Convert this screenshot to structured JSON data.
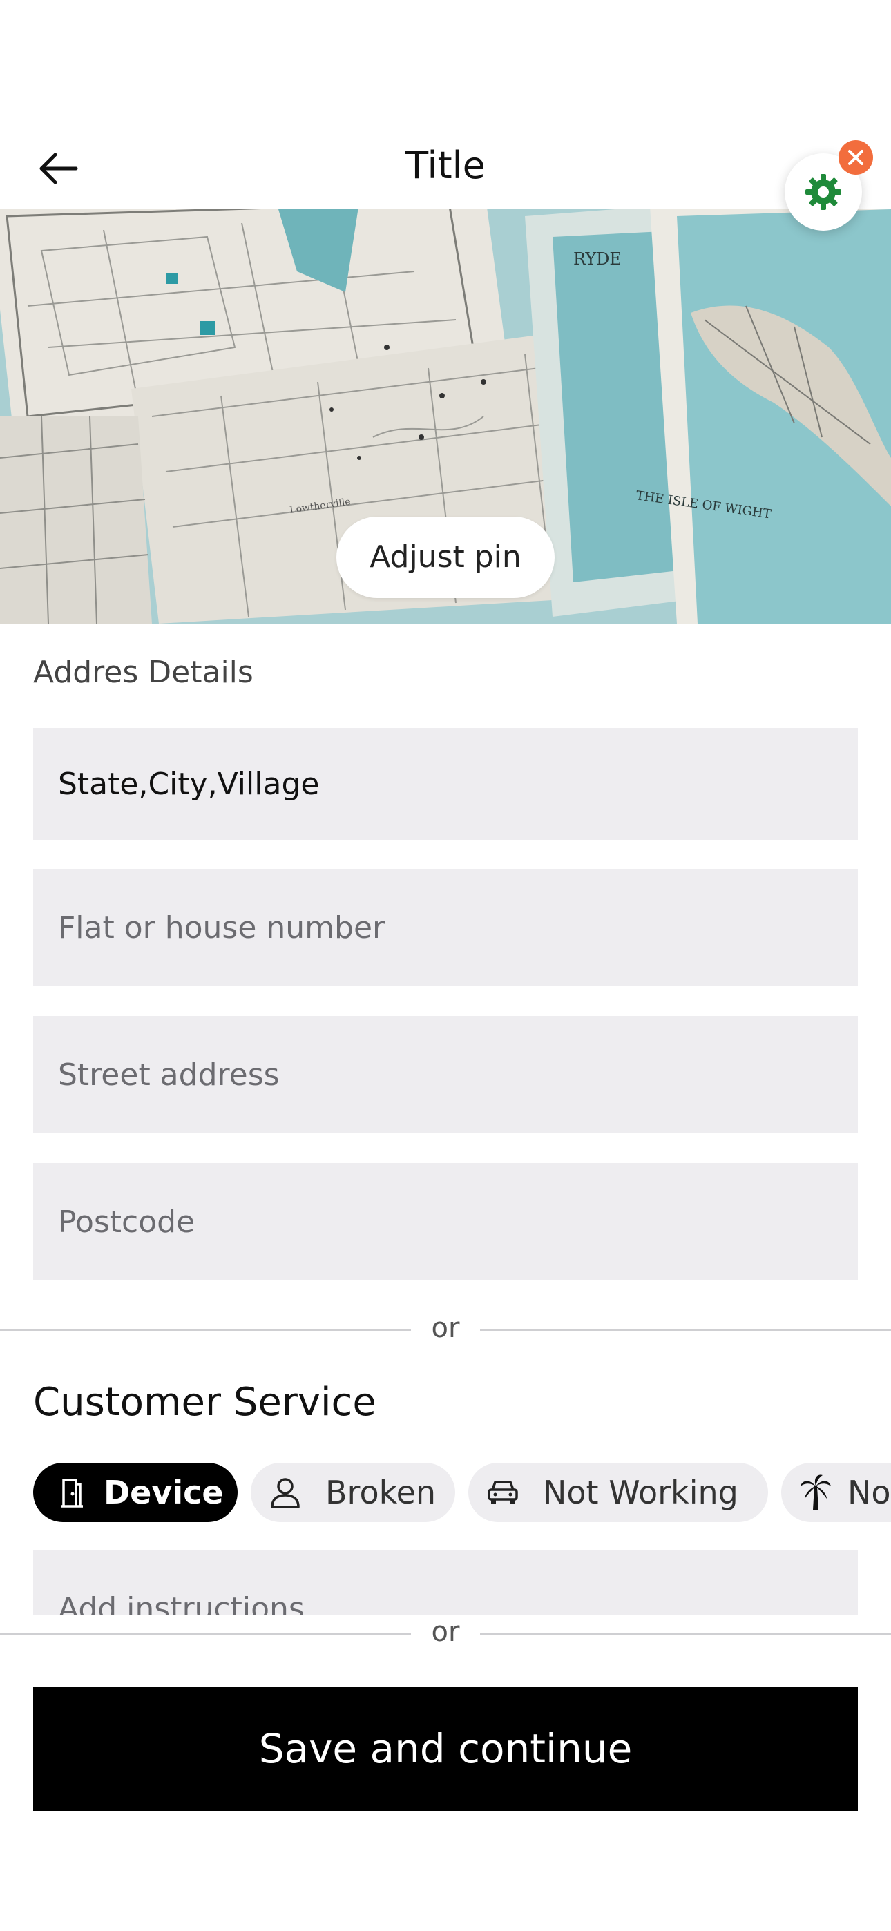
{
  "header": {
    "title": "Title",
    "back_icon": "arrow-left-icon",
    "settings_icon": "gear-icon",
    "close_icon": "close-icon"
  },
  "map": {
    "adjust_pin_label": "Adjust pin",
    "labels": [
      "RYDE",
      "THE ISLE OF WIGHT",
      "Lowtherville"
    ]
  },
  "address": {
    "section_label": "Addres Details",
    "location_value": "State,City,Village",
    "flat_placeholder": "Flat or house number",
    "street_placeholder": "Street address",
    "postcode_placeholder": "Postcode"
  },
  "separator_text": "or",
  "customer_service": {
    "title": "Customer Service",
    "chips": [
      {
        "label": "Device",
        "icon": "door-icon",
        "active": true
      },
      {
        "label": "Broken",
        "icon": "person-icon",
        "active": false
      },
      {
        "label": "Not Working",
        "icon": "car-icon",
        "active": false
      },
      {
        "label": "No",
        "icon": "palm-tree-icon",
        "active": false
      }
    ],
    "instructions_placeholder": "Add instructions"
  },
  "footer": {
    "save_label": "Save and continue"
  },
  "colors": {
    "accent_close": "#f26d3d",
    "gear": "#1f8a3a",
    "field_bg": "#eeedf0",
    "primary_button": "#000000"
  }
}
